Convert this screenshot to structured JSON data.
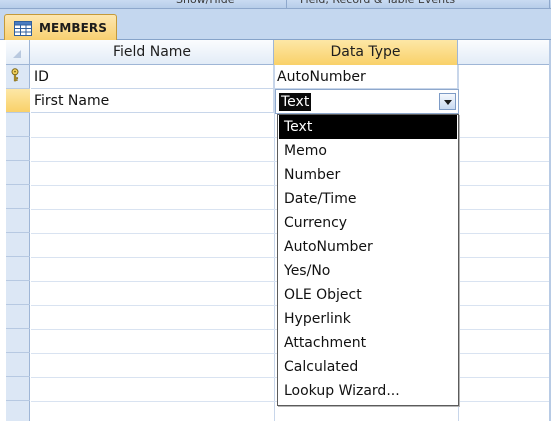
{
  "ribbon": {
    "group_1": "Show/Hide",
    "group_2": "Field, Record & Table Events"
  },
  "tab": {
    "label": "MEMBERS",
    "icon": "table-icon"
  },
  "columns": {
    "field_name": "Field Name",
    "data_type": "Data Type"
  },
  "rows": [
    {
      "field_name": "ID",
      "data_type": "AutoNumber",
      "primary_key": true,
      "key_icon": "key-icon"
    },
    {
      "field_name": "First Name",
      "data_type": "Text",
      "current": true
    }
  ],
  "combo": {
    "value": "Text",
    "icon": "chevron-down-icon"
  },
  "dropdown": {
    "options": [
      "Text",
      "Memo",
      "Number",
      "Date/Time",
      "Currency",
      "AutoNumber",
      "Yes/No",
      "OLE Object",
      "Hyperlink",
      "Attachment",
      "Calculated",
      "Lookup Wizard..."
    ],
    "selected_index": 0
  },
  "colors": {
    "active_header": "#f9d169",
    "tab_fill": "#f8cf6e",
    "selector_column": "#dce7f5",
    "selection": "#000000"
  }
}
